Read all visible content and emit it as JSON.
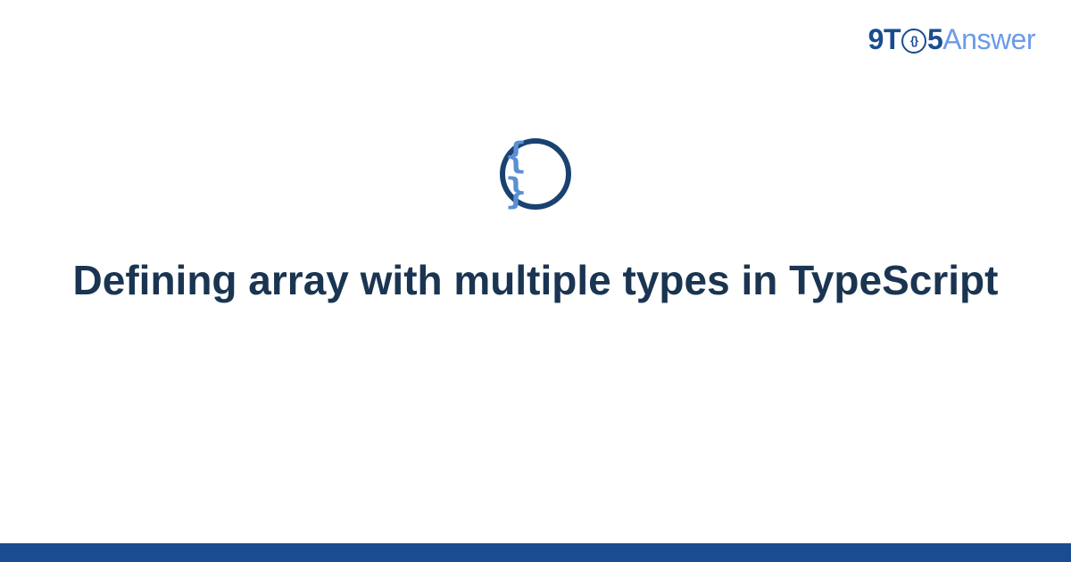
{
  "logo": {
    "prefix": "9T",
    "circleInner": "{}",
    "after": "5",
    "suffix": "Answer"
  },
  "icon": {
    "glyph": "{ }"
  },
  "title": "Defining array with multiple types in TypeScript"
}
